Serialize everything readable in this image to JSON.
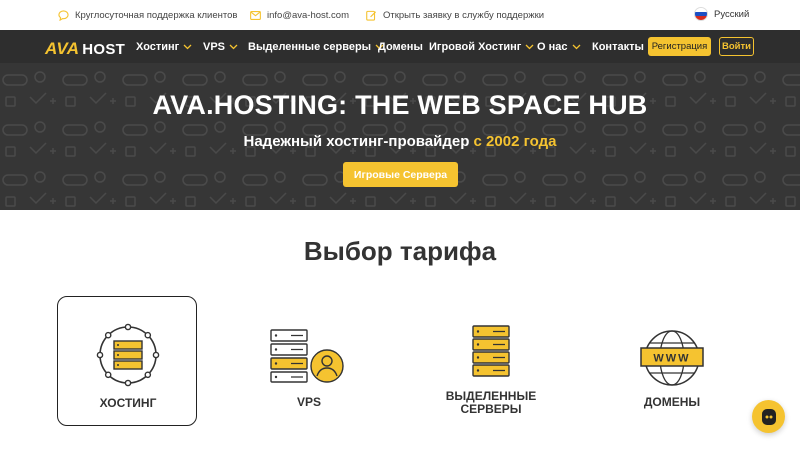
{
  "topbar": {
    "support_text": "Круглосуточная поддержка клиентов",
    "email": "info@ava-host.com",
    "ticket_text": "Открыть заявку в службу поддержки",
    "language": "Русский"
  },
  "nav": {
    "logo_ava": "AVA",
    "logo_host": "HOST",
    "items": [
      {
        "label": "Хостинг",
        "dropdown": true
      },
      {
        "label": "VPS",
        "dropdown": true
      },
      {
        "label": "Выделенные серверы",
        "dropdown": true
      },
      {
        "label": "Домены",
        "dropdown": false
      },
      {
        "label": "Игровой Хостинг",
        "dropdown": true
      },
      {
        "label": "О нас",
        "dropdown": true
      },
      {
        "label": "Контакты",
        "dropdown": false
      }
    ],
    "register_label": "Регистрация",
    "login_label": "Войти"
  },
  "hero": {
    "title": "AVA.HOSTING: THE WEB SPACE HUB",
    "subtitle_main": "Надежный хостинг-провайдер ",
    "subtitle_accent": "с 2002 года",
    "button_label": "Игровые Сервера"
  },
  "tariffs": {
    "title": "Выбор тарифа",
    "items": [
      {
        "label": "ХОСТИНГ",
        "icon": "hosting-icon",
        "active": true
      },
      {
        "label": "VPS",
        "icon": "vps-icon",
        "active": false
      },
      {
        "label": "ВЫДЕЛЕННЫЕ СЕРВЕРЫ",
        "icon": "dedicated-server-icon",
        "active": false
      },
      {
        "label": "ДОМЕНЫ",
        "icon": "domain-globe-icon",
        "active": false
      }
    ]
  },
  "colors": {
    "accent": "#f5c330",
    "dark": "#2e2e2e",
    "hero_bg": "#363636"
  }
}
